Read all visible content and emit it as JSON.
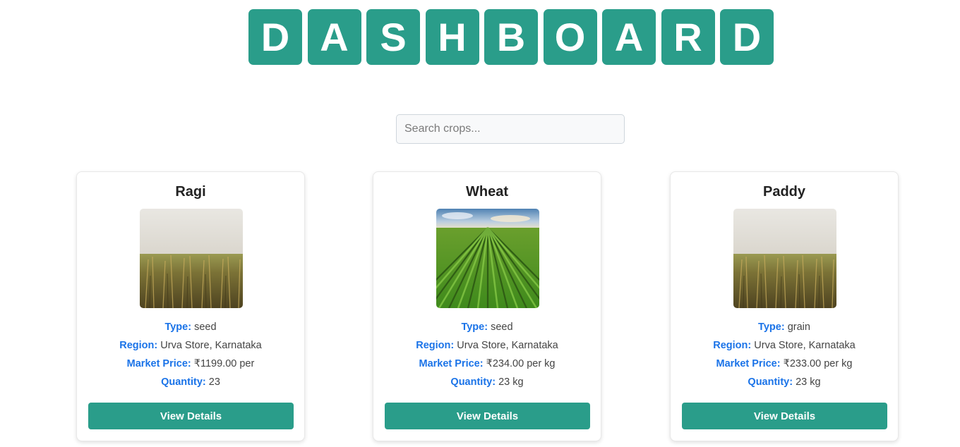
{
  "title": {
    "letters": [
      "D",
      "A",
      "S",
      "H",
      "B",
      "O",
      "A",
      "R",
      "D"
    ],
    "tile_color": "#2a9d8a"
  },
  "search": {
    "placeholder": "Search crops...",
    "value": ""
  },
  "labels": {
    "type": "Type:",
    "region": "Region:",
    "market_price": "Market Price:",
    "quantity": "Quantity:"
  },
  "cards": [
    {
      "name": "Ragi",
      "image": "wheat-field-photo",
      "type": "seed",
      "region": "Urva Store, Karnataka",
      "market_price": "₹1199.00 per",
      "quantity": "23",
      "button_label": "View Details"
    },
    {
      "name": "Wheat",
      "image": "green-crop-rows-photo",
      "type": "seed",
      "region": "Urva Store, Karnataka",
      "market_price": "₹234.00 per kg",
      "quantity": "23 kg",
      "button_label": "View Details"
    },
    {
      "name": "Paddy",
      "image": "wheat-field-photo",
      "type": "grain",
      "region": "Urva Store, Karnataka",
      "market_price": "₹233.00 per kg",
      "quantity": "23 kg",
      "button_label": "View Details"
    }
  ],
  "colors": {
    "accent": "#2a9d8a",
    "label": "#1a73e8"
  }
}
